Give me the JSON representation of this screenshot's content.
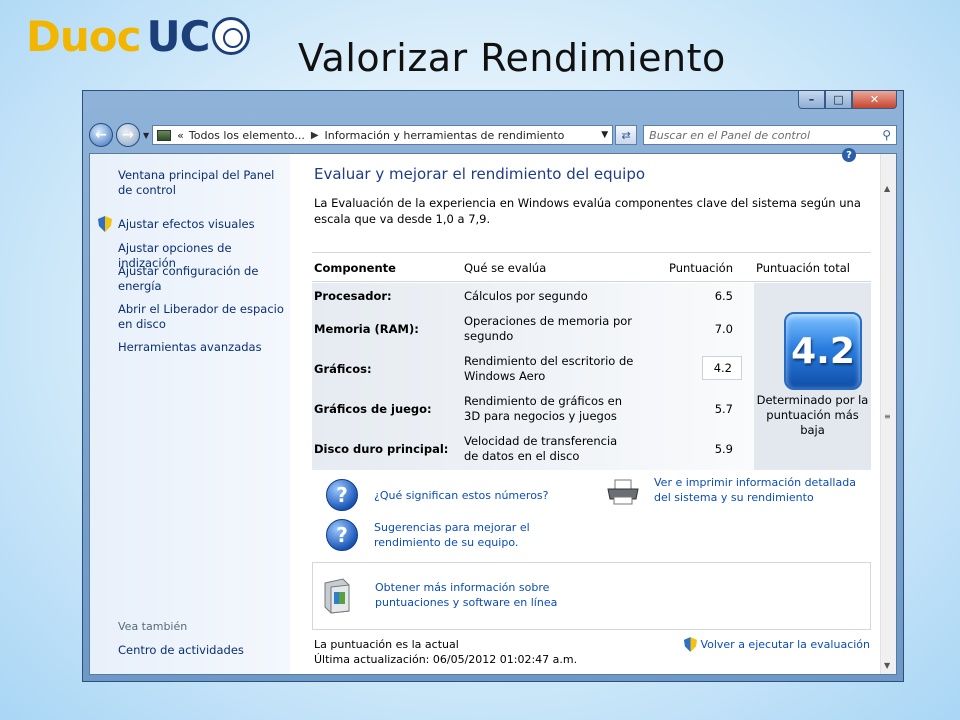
{
  "slide": {
    "logo_left": "Duoc",
    "logo_right": "UC",
    "title": "Valorizar Rendimiento"
  },
  "window": {
    "controls": {
      "minimize": "–",
      "maximize": "□",
      "close": "✕"
    },
    "nav": {
      "breadcrumb_prefix": "«",
      "crumb1": "Todos los elemento...",
      "crumb2": "Información y herramientas de rendimiento",
      "search_placeholder": "Buscar en el Panel de control"
    }
  },
  "sidebar": {
    "items": [
      "Ventana principal del Panel de control",
      "Ajustar efectos visuales",
      "Ajustar opciones de indización",
      "Ajustar configuración de energía",
      "Abrir el Liberador de espacio en disco",
      "Herramientas avanzadas"
    ],
    "see_also_label": "Vea también",
    "see_also_link": "Centro de actividades"
  },
  "main": {
    "heading": "Evaluar y mejorar el rendimiento del equipo",
    "description": "La Evaluación de la experiencia en Windows evalúa componentes clave del sistema según una escala que va desde 1,0 a 7,9.",
    "columns": [
      "Componente",
      "Qué se evalúa",
      "Puntuación",
      "Puntuación total"
    ],
    "rows": [
      {
        "component": "Procesador:",
        "measure": "Cálculos por segundo",
        "score": "6.5"
      },
      {
        "component": "Memoria (RAM):",
        "measure": "Operaciones de memoria por segundo",
        "score": "7.0"
      },
      {
        "component": "Gráficos:",
        "measure": "Rendimiento del escritorio de Windows Aero",
        "score": "4.2"
      },
      {
        "component": "Gráficos de juego:",
        "measure": "Rendimiento de gráficos en 3D para negocios y juegos",
        "score": "5.7"
      },
      {
        "component": "Disco duro principal:",
        "measure": "Velocidad de transferencia de datos en el disco",
        "score": "5.9"
      }
    ],
    "total_score": "4.2",
    "total_caption": "Determinado por la puntuación más baja",
    "links": {
      "what_numbers": "¿Qué significan estos números?",
      "tips": "Sugerencias para mejorar el rendimiento de su equipo.",
      "print_details": "Ver e imprimir información detallada del sistema y su rendimiento",
      "more_info": "Obtener más información sobre puntuaciones y software en línea"
    },
    "footer": {
      "status": "La puntuación es la actual",
      "last_update": "Última actualización: 06/05/2012 01:02:47 a.m.",
      "rerun": "Volver a ejecutar la evaluación"
    }
  }
}
